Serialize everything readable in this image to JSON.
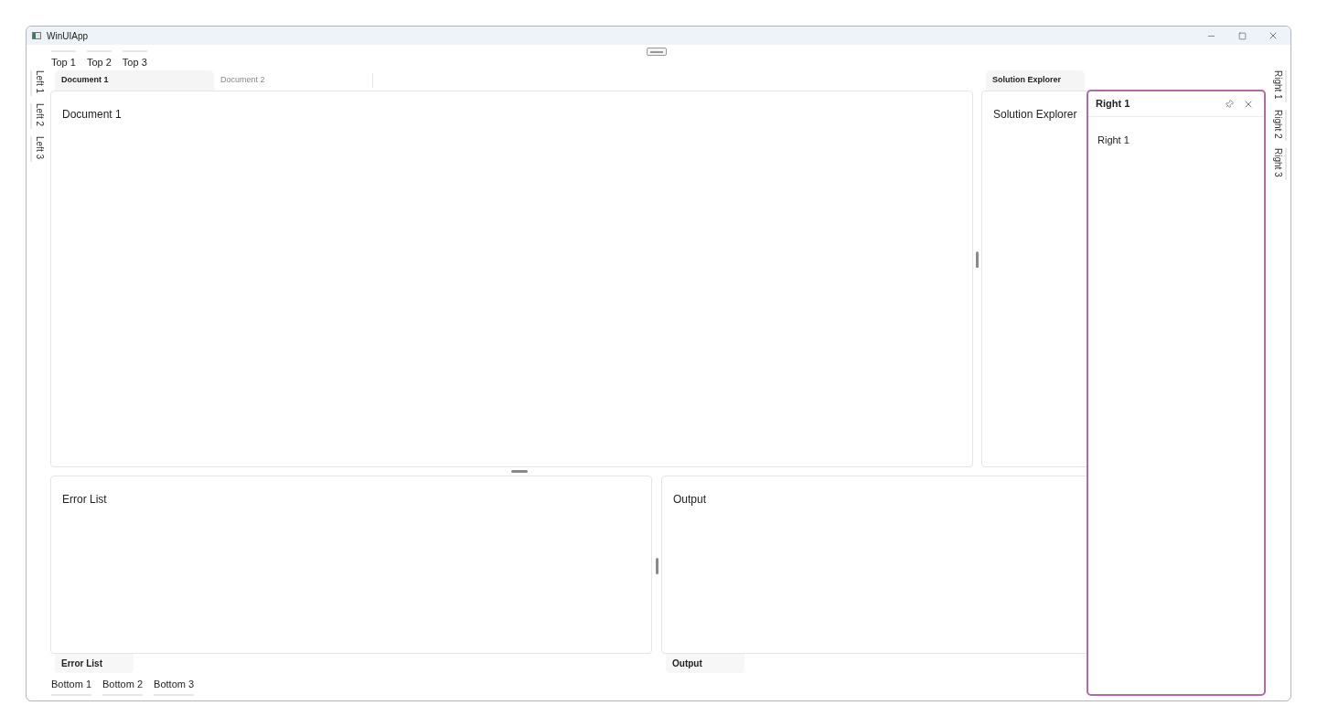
{
  "window": {
    "title": "WinUIApp"
  },
  "top_tabs": [
    {
      "label": "Top 1"
    },
    {
      "label": "Top 2"
    },
    {
      "label": "Top 3"
    }
  ],
  "left_tabs": [
    {
      "label": "Left 1"
    },
    {
      "label": "Left 2"
    },
    {
      "label": "Left 3"
    }
  ],
  "right_tabs": [
    {
      "label": "Right 1"
    },
    {
      "label": "Right 2"
    },
    {
      "label": "Right 3"
    }
  ],
  "bottom_tabs": [
    {
      "label": "Bottom 1"
    },
    {
      "label": "Bottom 2"
    },
    {
      "label": "Bottom 3"
    }
  ],
  "documents": {
    "tabs": [
      {
        "label": "Document 1",
        "selected": true
      },
      {
        "label": "Document 2",
        "selected": false
      }
    ],
    "content": "Document 1"
  },
  "solution_explorer": {
    "tab": "Solution Explorer",
    "content": "Solution Explorer"
  },
  "error_list": {
    "tab": "Error List",
    "content": "Error List"
  },
  "output": {
    "tab": "Output",
    "content": "Output"
  },
  "flyout": {
    "title": "Right 1",
    "content": "Right 1"
  }
}
